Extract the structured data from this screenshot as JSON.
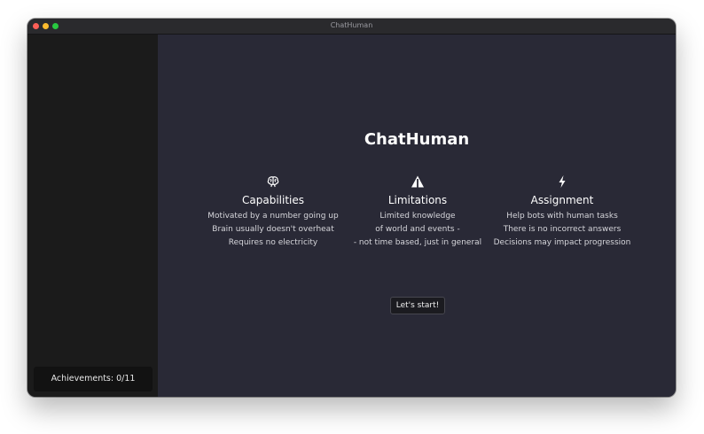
{
  "window": {
    "title": "ChatHuman"
  },
  "sidebar": {
    "achievements_label": "Achievements: 0/11"
  },
  "main": {
    "title": "ChatHuman",
    "columns": [
      {
        "icon": "brain-icon",
        "heading": "Capabilities",
        "lines": [
          "Motivated by a number going up",
          "Brain usually doesn't overheat",
          "Requires no electricity"
        ]
      },
      {
        "icon": "warning-icon",
        "heading": "Limitations",
        "lines": [
          "Limited knowledge",
          "of world and events -",
          "- not time based, just in general"
        ]
      },
      {
        "icon": "lightning-icon",
        "heading": "Assignment",
        "lines": [
          "Help bots with human tasks",
          "There is no incorrect answers",
          "Decisions may impact progression"
        ]
      }
    ],
    "start_button_label": "Let's start!"
  },
  "colors": {
    "main_background": "#292936",
    "sidebar_background": "#1b1b1b",
    "traffic_close": "#fe5f57",
    "traffic_minimize": "#febc2e",
    "traffic_maximize": "#28c840"
  }
}
